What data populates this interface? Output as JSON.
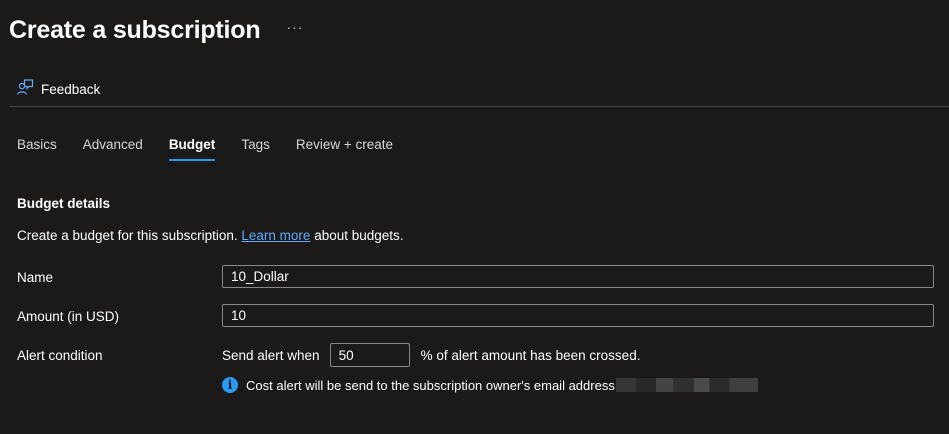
{
  "header": {
    "title": "Create a subscription",
    "more_label": "···"
  },
  "command_bar": {
    "feedback_label": "Feedback"
  },
  "tabs": [
    {
      "label": "Basics"
    },
    {
      "label": "Advanced"
    },
    {
      "label": "Budget"
    },
    {
      "label": "Tags"
    },
    {
      "label": "Review + create"
    }
  ],
  "active_tab": "Budget",
  "budget": {
    "section_title": "Budget details",
    "description_prefix": "Create a budget for this subscription.",
    "learn_more_label": "Learn more",
    "description_suffix": "about budgets.",
    "name_label": "Name",
    "name_value": "10_Dollar",
    "amount_label": "Amount (in USD)",
    "amount_value": "10",
    "alert_label": "Alert condition",
    "alert_prefix": "Send alert when",
    "alert_value": "50",
    "alert_suffix": "% of alert amount has been crossed.",
    "info_text": "Cost alert will be send to the subscription owner's email address"
  },
  "colors": {
    "background": "#1b1a19",
    "accent": "#2899f5",
    "link": "#60aaff",
    "border": "#8a8886"
  },
  "icons": {
    "feedback": "feedback-person-icon",
    "info": "info-icon"
  }
}
